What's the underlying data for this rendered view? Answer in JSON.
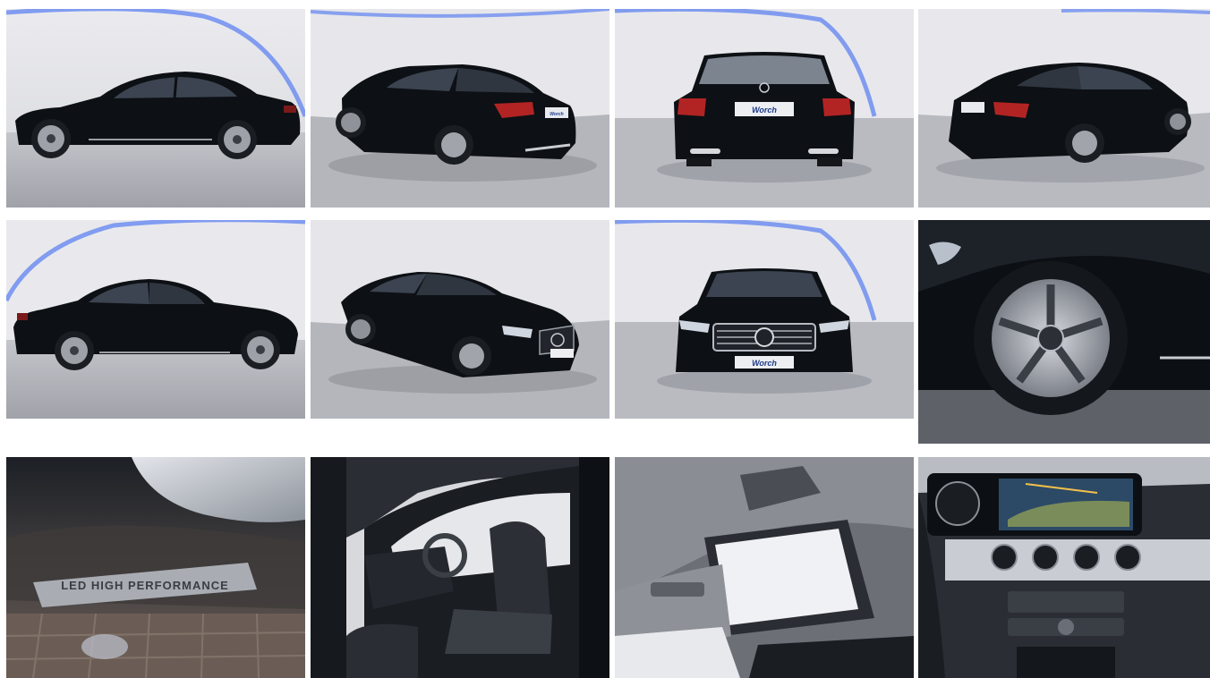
{
  "gallery": {
    "photos": [
      {
        "view": "side-left"
      },
      {
        "view": "rear-three-quarter-left"
      },
      {
        "view": "rear"
      },
      {
        "view": "rear-three-quarter-right"
      },
      {
        "view": "side-right"
      },
      {
        "view": "front-three-quarter-right"
      },
      {
        "view": "front"
      },
      {
        "view": "wheel-closeup"
      },
      {
        "view": "headlight-badge-closeup",
        "badge_text": "LED HIGH PERFORMANCE"
      },
      {
        "view": "interior-driver-door-open"
      },
      {
        "view": "sunroof-interior"
      },
      {
        "view": "dashboard-navigation"
      }
    ]
  },
  "dealer": {
    "plate_text": "Worch"
  },
  "colors": {
    "car_paint": "#0d1014",
    "studio_wall": "#e6e6ea",
    "studio_floor": "#a9abb1",
    "led_accent": "#6f8ef0"
  }
}
